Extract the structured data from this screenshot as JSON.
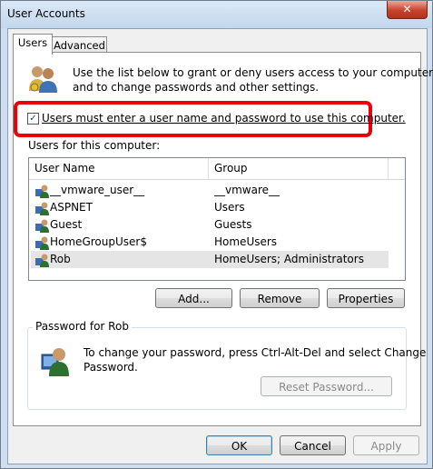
{
  "window": {
    "title": "User Accounts",
    "close_label": "✕"
  },
  "tabs": [
    {
      "label": "Users"
    },
    {
      "label": "Advanced"
    }
  ],
  "intro": {
    "line1": "Use the list below to grant or deny users access to your computer,",
    "line2": "and to change passwords and other settings."
  },
  "checkbox": {
    "checked": true,
    "label": "Users must enter a user name and password to use this computer."
  },
  "list": {
    "caption": "Users for this computer:",
    "columns": [
      "User Name",
      "Group"
    ],
    "rows": [
      {
        "name": "__vmware_user__",
        "group": "__vmware__"
      },
      {
        "name": "ASPNET",
        "group": "Users"
      },
      {
        "name": "Guest",
        "group": "Guests"
      },
      {
        "name": "HomeGroupUser$",
        "group": "HomeUsers"
      },
      {
        "name": "Rob",
        "group": "HomeUsers; Administrators",
        "selected": true
      }
    ]
  },
  "buttons": {
    "add": "Add...",
    "remove": "Remove",
    "properties": "Properties"
  },
  "password": {
    "group_label": "Password for Rob",
    "line1": "To change your password, press Ctrl-Alt-Del and select Change",
    "line2": "Password.",
    "reset_label": "Reset Password..."
  },
  "footer": {
    "ok": "OK",
    "cancel": "Cancel",
    "apply": "Apply"
  }
}
